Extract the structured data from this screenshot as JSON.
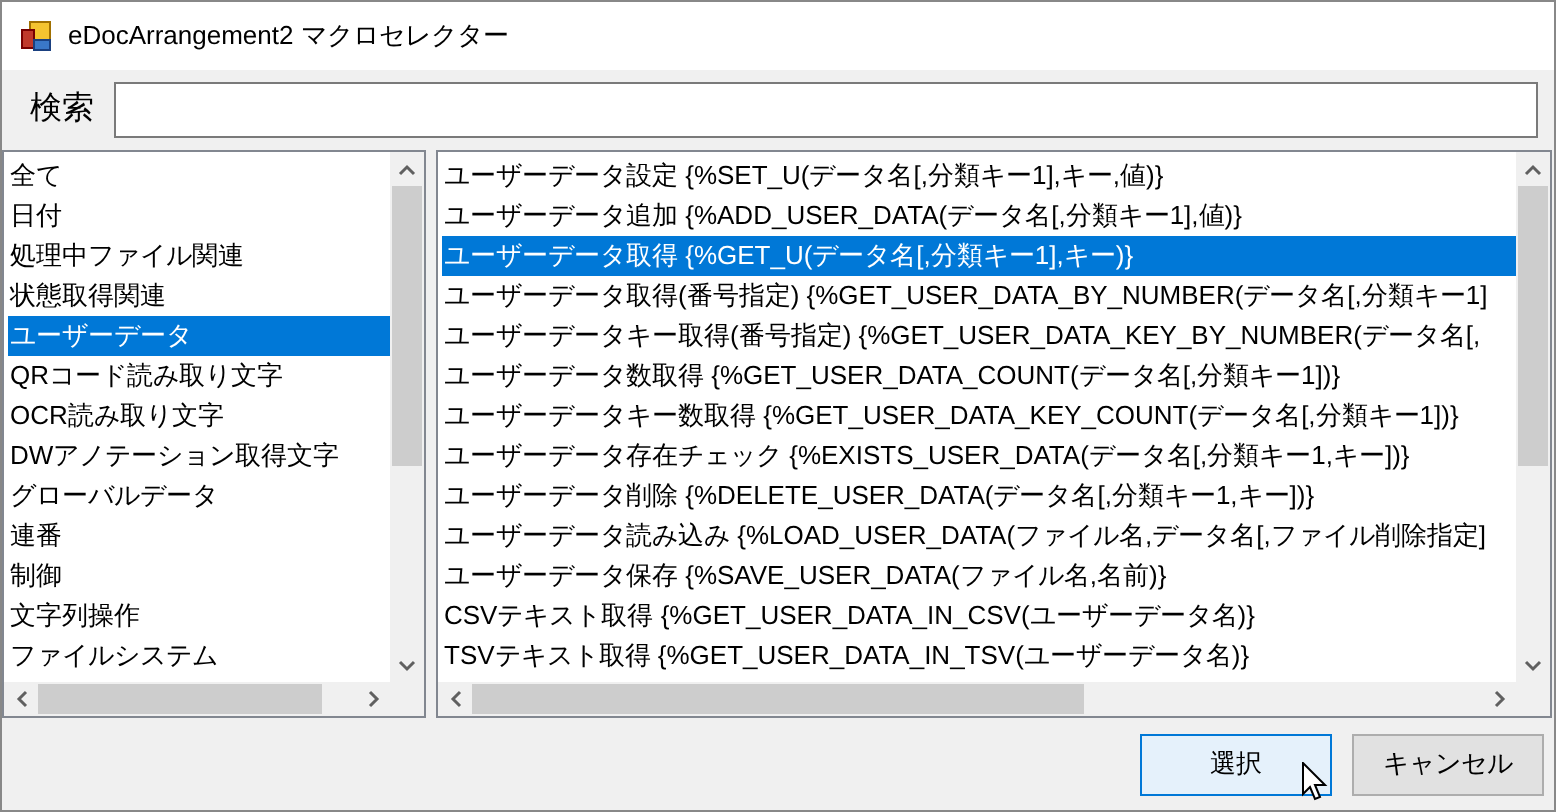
{
  "window": {
    "title": "eDocArrangement2 マクロセレクター"
  },
  "search": {
    "label": "検索"
  },
  "categories": [
    {
      "label": "全て",
      "selected": false
    },
    {
      "label": "日付",
      "selected": false
    },
    {
      "label": "処理中ファイル関連",
      "selected": false
    },
    {
      "label": "状態取得関連",
      "selected": false
    },
    {
      "label": "ユーザーデータ",
      "selected": true
    },
    {
      "label": "QRコード読み取り文字",
      "selected": false
    },
    {
      "label": "OCR読み取り文字",
      "selected": false
    },
    {
      "label": "DWアノテーション取得文字",
      "selected": false
    },
    {
      "label": "グローバルデータ",
      "selected": false
    },
    {
      "label": "連番",
      "selected": false
    },
    {
      "label": "制御",
      "selected": false
    },
    {
      "label": "文字列操作",
      "selected": false
    },
    {
      "label": "ファイルシステム",
      "selected": false
    }
  ],
  "macros": [
    {
      "label": "ユーザーデータ設定 {%SET_U(データ名[,分類キー1],キー,値)}",
      "selected": false
    },
    {
      "label": "ユーザーデータ追加 {%ADD_USER_DATA(データ名[,分類キー1],値)}",
      "selected": false
    },
    {
      "label": "ユーザーデータ取得 {%GET_U(データ名[,分類キー1],キー)}",
      "selected": true
    },
    {
      "label": "ユーザーデータ取得(番号指定) {%GET_USER_DATA_BY_NUMBER(データ名[,分類キー1]",
      "selected": false
    },
    {
      "label": "ユーザーデータキー取得(番号指定) {%GET_USER_DATA_KEY_BY_NUMBER(データ名[,",
      "selected": false
    },
    {
      "label": "ユーザーデータ数取得 {%GET_USER_DATA_COUNT(データ名[,分類キー1])}",
      "selected": false
    },
    {
      "label": "ユーザーデータキー数取得 {%GET_USER_DATA_KEY_COUNT(データ名[,分類キー1])}",
      "selected": false
    },
    {
      "label": "ユーザーデータ存在チェック {%EXISTS_USER_DATA(データ名[,分類キー1,キー])}",
      "selected": false
    },
    {
      "label": "ユーザーデータ削除 {%DELETE_USER_DATA(データ名[,分類キー1,キー])}",
      "selected": false
    },
    {
      "label": "ユーザーデータ読み込み {%LOAD_USER_DATA(ファイル名,データ名[,ファイル削除指定]",
      "selected": false
    },
    {
      "label": "ユーザーデータ保存 {%SAVE_USER_DATA(ファイル名,名前)}",
      "selected": false
    },
    {
      "label": "CSVテキスト取得 {%GET_USER_DATA_IN_CSV(ユーザーデータ名)}",
      "selected": false
    },
    {
      "label": "TSVテキスト取得 {%GET_USER_DATA_IN_TSV(ユーザーデータ名)}",
      "selected": false
    }
  ],
  "buttons": [
    {
      "label": "選択",
      "kind": "default"
    },
    {
      "label": "キャンセル",
      "kind": "normal"
    }
  ]
}
